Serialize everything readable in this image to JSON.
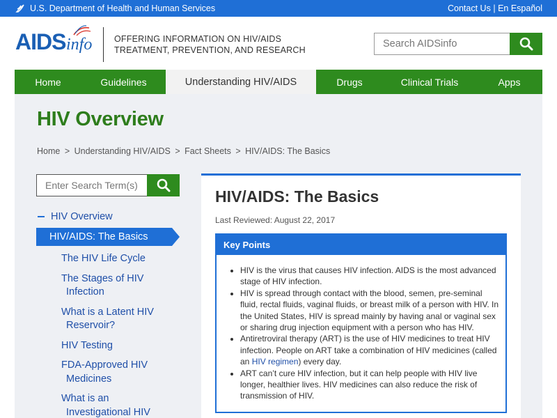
{
  "topbar": {
    "hhs_label": "U.S. Department of Health and Human Services",
    "contact_label": "Contact Us",
    "separator": "|",
    "espanol_label": "En Español"
  },
  "header": {
    "logo_aids": "AIDS",
    "logo_info": "info",
    "tagline_line1": "OFFERING INFORMATION ON HIV/AIDS",
    "tagline_line2": "TREATMENT, PREVENTION, AND RESEARCH",
    "search_placeholder": "Search AIDSinfo"
  },
  "nav": {
    "items": [
      {
        "label": "Home"
      },
      {
        "label": "Guidelines"
      },
      {
        "label": "Understanding HIV/AIDS"
      },
      {
        "label": "Drugs"
      },
      {
        "label": "Clinical Trials"
      },
      {
        "label": "Apps"
      }
    ]
  },
  "page": {
    "title": "HIV Overview",
    "breadcrumb": [
      "Home",
      "Understanding HIV/AIDS",
      "Fact Sheets",
      "HIV/AIDS: The Basics"
    ],
    "breadcrumb_sep": ">"
  },
  "sidebar": {
    "search_placeholder": "Enter Search Term(s)",
    "section_label": "HIV Overview",
    "active_label": "HIV/AIDS: The Basics",
    "items": [
      {
        "line1": "The HIV Life Cycle",
        "line2": ""
      },
      {
        "line1": "The Stages of HIV",
        "line2": "Infection"
      },
      {
        "line1": "What is a Latent HIV",
        "line2": "Reservoir?"
      },
      {
        "line1": "HIV Testing",
        "line2": ""
      },
      {
        "line1": "FDA-Approved HIV",
        "line2": "Medicines"
      },
      {
        "line1": "What is an",
        "line2": "Investigational HIV"
      }
    ]
  },
  "article": {
    "title": "HIV/AIDS: The Basics",
    "reviewed": "Last Reviewed: August 22, 2017",
    "key_points_title": "Key Points",
    "points": [
      {
        "text": "HIV is the virus that causes HIV infection. AIDS is the most advanced stage of HIV infection."
      },
      {
        "text": "HIV is spread through contact with the blood, semen, pre-seminal fluid, rectal fluids, vaginal fluids, or breast milk of a person with HIV. In the United States, HIV is spread mainly by having anal or vaginal sex or sharing drug injection equipment with a person who has HIV."
      },
      {
        "text_before": "Antiretroviral therapy (ART) is the use of HIV medicines to treat HIV infection. People on ART take a combination of HIV medicines (called an ",
        "link": "HIV regimen",
        "text_after": ") every day."
      },
      {
        "text": "ART can’t cure HIV infection, but it can help people with HIV live longer, healthier lives. HIV medicines can also reduce the risk of transmission of HIV."
      }
    ]
  },
  "colors": {
    "brand_blue": "#1f6fd6",
    "brand_green": "#2e8b1e",
    "title_green": "#2e7d1c",
    "link_blue": "#1f4fa8"
  }
}
